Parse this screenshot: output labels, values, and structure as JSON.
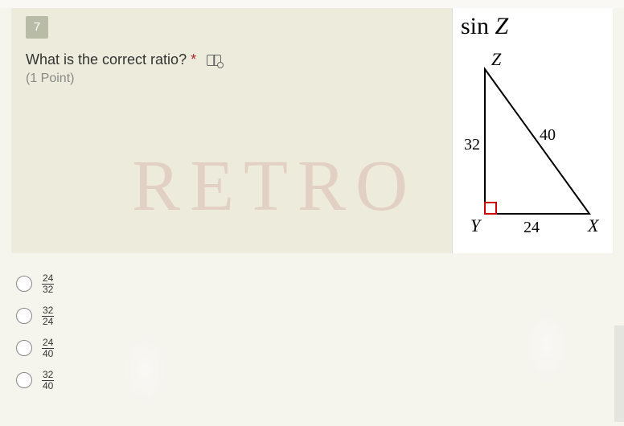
{
  "question": {
    "number": "7",
    "text": "What is the correct ratio?",
    "required_marker": "*",
    "points": "(1 Point)",
    "watermark": "RETRO"
  },
  "figure": {
    "expression_prefix": "sin ",
    "expression_var": "Z",
    "vertices": {
      "Z": "Z",
      "Y": "Y",
      "X": "X"
    },
    "sides": {
      "ZY": "32",
      "ZX": "40",
      "YX": "24"
    }
  },
  "options": [
    {
      "num": "24",
      "den": "32"
    },
    {
      "num": "32",
      "den": "24"
    },
    {
      "num": "24",
      "den": "40"
    },
    {
      "num": "32",
      "den": "40"
    }
  ]
}
